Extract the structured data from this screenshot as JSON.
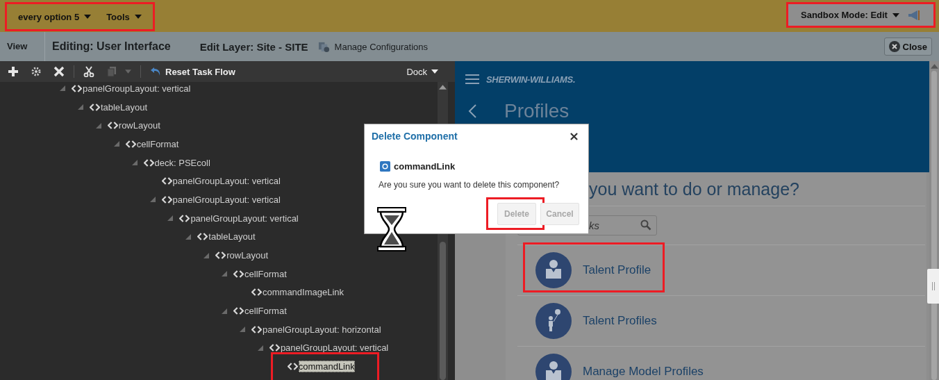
{
  "top_bar": {
    "menus_highlighted": true,
    "menus": [
      {
        "label": "every option 5"
      },
      {
        "label": "Tools"
      }
    ],
    "sandbox": {
      "label": "Sandbox Mode: Edit",
      "highlighted": true
    }
  },
  "edit_bar": {
    "view": "View",
    "editing": "Editing: User Interface",
    "layer": "Edit Layer: Site - SITE",
    "manage": "Manage Configurations",
    "close": "Close"
  },
  "toolbar": {
    "reset": "Reset Task Flow",
    "dock": "Dock"
  },
  "tree": [
    {
      "label": "panelGroupLayout: vertical",
      "expanded": true,
      "selected": false,
      "children": [
        {
          "label": "tableLayout",
          "expanded": true,
          "selected": false,
          "children": [
            {
              "label": "rowLayout",
              "expanded": true,
              "selected": false,
              "children": [
                {
                  "label": "cellFormat",
                  "expanded": true,
                  "selected": false,
                  "children": [
                    {
                      "label": "deck: PSEcoll",
                      "expanded": true,
                      "selected": false,
                      "children": [
                        {
                          "label": "panelGroupLayout: vertical",
                          "selected": false
                        },
                        {
                          "label": "panelGroupLayout: vertical",
                          "expanded": true,
                          "selected": false,
                          "children": [
                            {
                              "label": "panelGroupLayout: vertical",
                              "expanded": true,
                              "selected": false,
                              "children": [
                                {
                                  "label": "tableLayout",
                                  "expanded": true,
                                  "selected": false,
                                  "children": [
                                    {
                                      "label": "rowLayout",
                                      "expanded": true,
                                      "selected": false,
                                      "children": [
                                        {
                                          "label": "cellFormat",
                                          "expanded": true,
                                          "selected": false,
                                          "children": [
                                            {
                                              "label": "commandImageLink",
                                              "selected": false
                                            }
                                          ]
                                        },
                                        {
                                          "label": "cellFormat",
                                          "expanded": true,
                                          "selected": false,
                                          "children": [
                                            {
                                              "label": "panelGroupLayout: horizontal",
                                              "expanded": true,
                                              "selected": false,
                                              "children": [
                                                {
                                                  "label": "panelGroupLayout: vertical",
                                                  "expanded": true,
                                                  "selected": false,
                                                  "children": [
                                                    {
                                                      "label": "commandLink",
                                                      "selected": true,
                                                      "highlighted": true
                                                    }
                                                  ]
                                                }
                                              ]
                                            }
                                          ]
                                        }
                                      ]
                                    }
                                  ]
                                }
                              ]
                            }
                          ]
                        }
                      ]
                    }
                  ]
                }
              ]
            }
          ]
        }
      ]
    }
  ],
  "app": {
    "logo": "SHERWIN-WILLIAMS.",
    "title": "Profiles",
    "question": "you want to do or manage?",
    "search": {
      "placeholder": "ks"
    },
    "items": [
      {
        "label": "Talent Profile",
        "kind": "person",
        "highlighted": true
      },
      {
        "label": "Talent Profiles",
        "kind": "balloon",
        "highlighted": false
      },
      {
        "label": "Manage Model Profiles",
        "kind": "person",
        "highlighted": false
      }
    ]
  },
  "dialog": {
    "title": "Delete Component",
    "component": "commandLink",
    "message": "Are you sure you want to delete this component?",
    "buttons": [
      {
        "label": "Delete",
        "disabled": true,
        "highlighted": true
      },
      {
        "label": "Cancel",
        "disabled": true,
        "highlighted": false
      }
    ]
  }
}
